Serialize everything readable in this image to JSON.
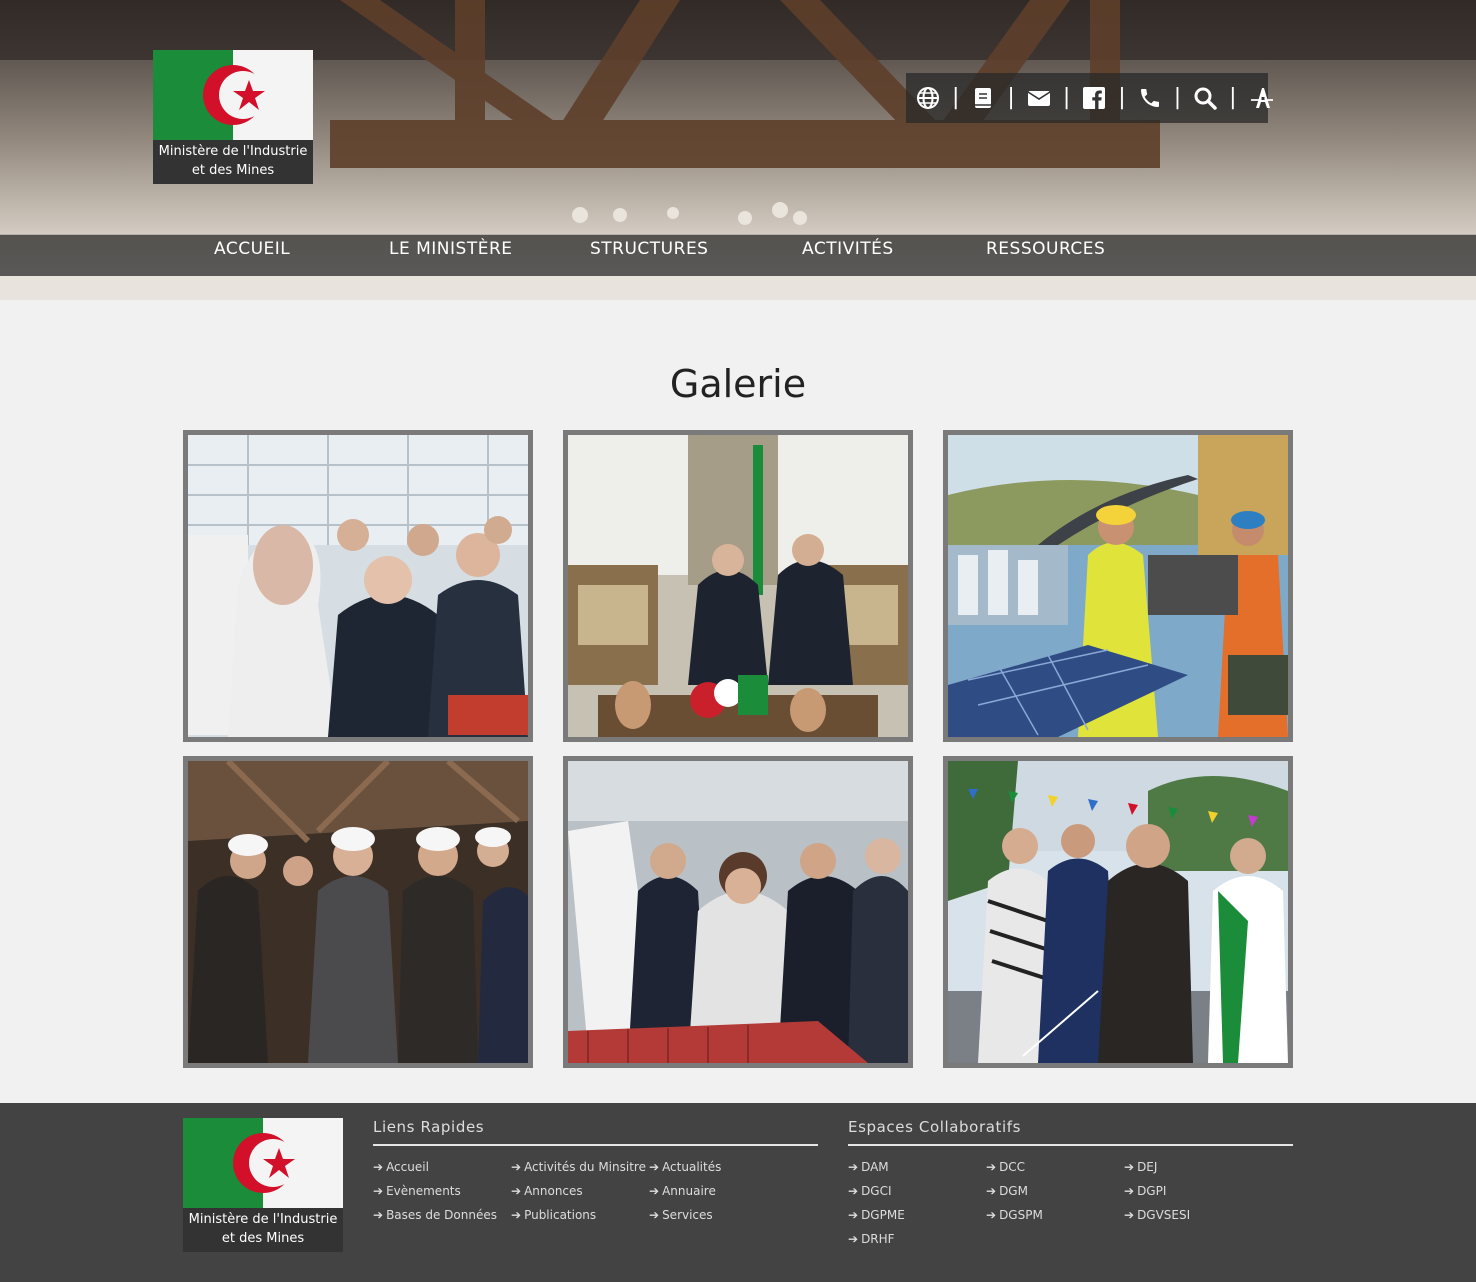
{
  "brand": {
    "name_line1": "Ministère de l'Industrie",
    "name_line2": "et des Mines"
  },
  "toolbar": {
    "icons": [
      "globe-icon",
      "book-icon",
      "envelope-icon",
      "facebook-icon",
      "phone-icon",
      "search-icon",
      "accessibility-icon"
    ],
    "separator": "|"
  },
  "nav": {
    "items": [
      {
        "label": "ACCUEIL"
      },
      {
        "label": "LE MINISTÈRE"
      },
      {
        "label": "STRUCTURES"
      },
      {
        "label": "ACTIVITÉS"
      },
      {
        "label": "RESSOURCES"
      }
    ]
  },
  "gallery": {
    "title": "Galerie",
    "items": [
      "factory-visit-photo",
      "official-meeting-photo",
      "industry-collage-photo",
      "plant-tour-photo",
      "workshop-presentation-photo",
      "outdoor-event-photo"
    ]
  },
  "footer": {
    "quick_links": {
      "title": "Liens Rapides",
      "items": [
        "Accueil",
        "Activités du Minsitre",
        "Actualités",
        "Evènements",
        "Annonces",
        "Annuaire",
        "Bases de Données",
        "Publications",
        "Services"
      ]
    },
    "collab": {
      "title": "Espaces Collaboratifs",
      "items": [
        "DAM",
        "DCC",
        "DEJ",
        "DGCI",
        "DGM",
        "DGPI",
        "DGPME",
        "DGSPM",
        "DGVSESI",
        "DRHF"
      ]
    },
    "arrow": "➔"
  },
  "colors": {
    "nav_bg": "#232323",
    "footer_bg": "#434343",
    "page_bg": "#f1f1f1",
    "flag_green": "#1b8c3a",
    "flag_red": "#d2102a"
  }
}
